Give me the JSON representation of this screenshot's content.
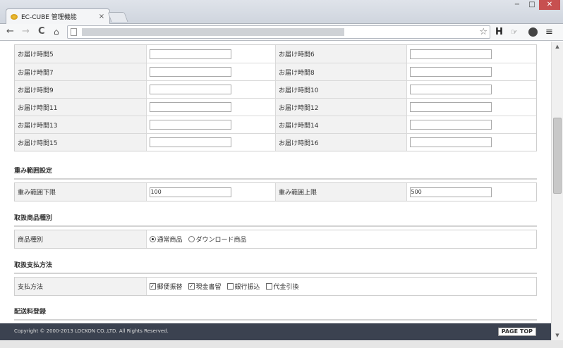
{
  "browser": {
    "tab_title": "EC-CUBE 管理機能",
    "tab_close": "×",
    "win_min": "−",
    "win_max": "□",
    "win_close": "✕",
    "back": "←",
    "forward": "→",
    "reload": "C",
    "home": "⌂",
    "star": "☆",
    "ext_h": "H",
    "ext_hand": "☞",
    "menu": "≡"
  },
  "delivery_times": {
    "rows": [
      {
        "label_a": "お届け時間5",
        "value_a": "",
        "label_b": "お届け時間6",
        "value_b": ""
      },
      {
        "label_a": "お届け時間7",
        "value_a": "",
        "label_b": "お届け時間8",
        "value_b": ""
      },
      {
        "label_a": "お届け時間9",
        "value_a": "",
        "label_b": "お届け時間10",
        "value_b": ""
      },
      {
        "label_a": "お届け時間11",
        "value_a": "",
        "label_b": "お届け時間12",
        "value_b": ""
      },
      {
        "label_a": "お届け時間13",
        "value_a": "",
        "label_b": "お届け時間14",
        "value_b": ""
      },
      {
        "label_a": "お届け時間15",
        "value_a": "",
        "label_b": "お届け時間16",
        "value_b": ""
      }
    ]
  },
  "weight": {
    "section_title": "重み範囲設定",
    "lower_label": "重み範囲下限",
    "lower_value": "100",
    "upper_label": "重み範囲上限",
    "upper_value": "500"
  },
  "product_type": {
    "section_title": "取扱商品種別",
    "label": "商品種別",
    "options": [
      "通常商品",
      "ダウンロード商品"
    ],
    "selected": "通常商品"
  },
  "payment": {
    "section_title": "取扱支払方法",
    "label": "支払方法",
    "options": [
      {
        "label": "郵便振替",
        "checked": true
      },
      {
        "label": "現金書留",
        "checked": true
      },
      {
        "label": "銀行振込",
        "checked": false
      },
      {
        "label": "代金引換",
        "checked": false
      }
    ]
  },
  "shipping": {
    "section_title": "配送料登録"
  },
  "footer": {
    "copyright": "Copyright © 2000-2013 LOCKON CO.,LTD. All Rights Reserved.",
    "page_top": "PAGE TOP"
  },
  "scrollbar": {
    "up": "▲",
    "down": "▼"
  }
}
